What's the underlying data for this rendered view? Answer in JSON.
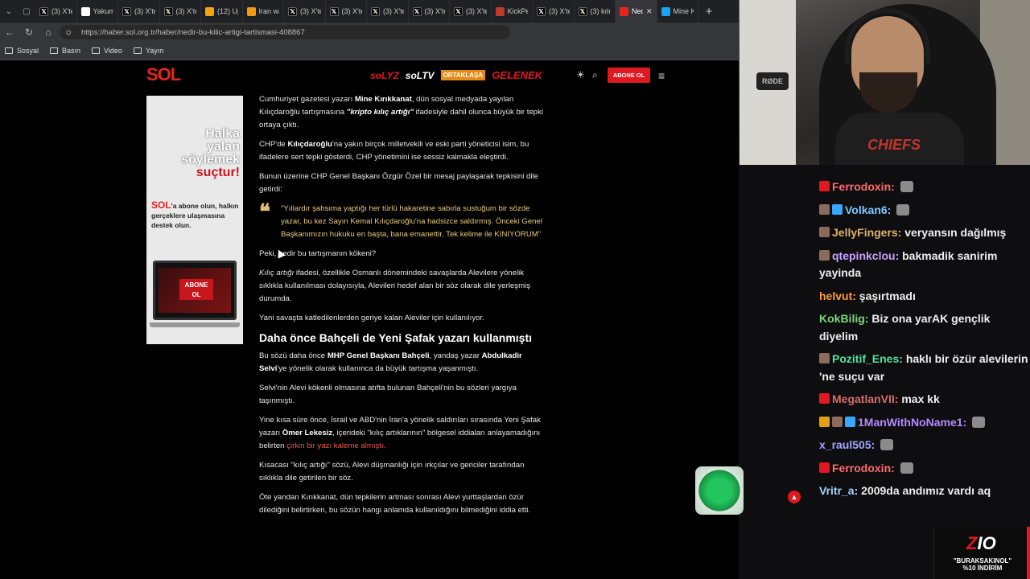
{
  "browser": {
    "tabs": [
      {
        "label": "(3) X'te",
        "icon": "x-icon",
        "color": "#000000"
      },
      {
        "label": "Yakumo",
        "icon": "amazon-icon",
        "color": "#ffffff"
      },
      {
        "label": "(3) X'te",
        "icon": "x-icon",
        "color": "#000000"
      },
      {
        "label": "(3) X'te",
        "icon": "x-icon",
        "color": "#000000"
      },
      {
        "label": "(12) Up",
        "icon": "upwork-icon",
        "color": "#f2a413"
      },
      {
        "label": "Iran wa",
        "icon": "news-icon",
        "color": "#f29a12"
      },
      {
        "label": "(3) X'te",
        "icon": "x-icon",
        "color": "#000000"
      },
      {
        "label": "(3) X'te",
        "icon": "x-icon",
        "color": "#000000"
      },
      {
        "label": "(3) X'te",
        "icon": "x-icon",
        "color": "#000000"
      },
      {
        "label": "(3) X'te",
        "icon": "x-icon",
        "color": "#000000"
      },
      {
        "label": "(3) X'te",
        "icon": "x-icon",
        "color": "#000000"
      },
      {
        "label": "KickPee",
        "icon": "kick-icon",
        "color": "#c0392b"
      },
      {
        "label": "(3) X'te",
        "icon": "x-icon",
        "color": "#000000"
      },
      {
        "label": "(3) kılıç",
        "icon": "x-icon",
        "color": "#000000"
      },
      {
        "label": "Ned",
        "icon": "sol-icon",
        "color": "#e52420",
        "active": true
      },
      {
        "label": "Mine Kı",
        "icon": "twitter-icon",
        "color": "#1da1f2"
      }
    ],
    "url": "https://haber.sol.org.tr/haber/nedir-bu-kilic-artigi-tartismasi-408867",
    "bookmarks": [
      "Sosyal",
      "Basın",
      "Video",
      "Yayın"
    ]
  },
  "site": {
    "logo": "SOL",
    "brands": [
      {
        "label": "soLYZ",
        "color": "#e0181f"
      },
      {
        "label": "soLTV",
        "color": "#ffffff"
      },
      {
        "label": "ORTAKLAŞA",
        "color": "#e58a12"
      },
      {
        "label": "GELENEK",
        "color": "#e0181f"
      }
    ],
    "subscribe_label": "ABONE OL"
  },
  "ad": {
    "headline": [
      "Halka",
      "yalan",
      "söylemek"
    ],
    "headline_red": "suçtur!",
    "brand": "SOL",
    "text": "'a abone olun, halkın gerçeklere ulaşmasına destek olun.",
    "button": "ABONE OL"
  },
  "article": {
    "p1_a": "Cumhuriyet gazetesi yazarı ",
    "p1_b": "Mine Kırıkkanat",
    "p1_c": ", dün sosyal medyada yayılan Kılıçdaroğlu tartışmasına ",
    "p1_d": "\"kripto kılıç artığı\"",
    "p1_e": " ifadesiyle dahil olunca büyük bir tepki ortaya çıktı.",
    "p2_a": "CHP'de ",
    "p2_b": "Kılıçdaroğlu",
    "p2_c": "'na yakın birçok milletvekili ve eski parti yöneticisi isim, bu ifadelere sert tepki gösterdi, CHP yönetimini ise sessiz kalmakla eleştirdi.",
    "p3": "Bunun üzerine CHP Genel Başkanı Özgür Özel bir mesaj paylaşarak tepkisini dile getirdi:",
    "quote": "\"Yıllardır şahsıma yaptığı her türlü hakaretine sabırla sustuğum bir sözde yazar, bu kez Sayın Kemal Kılıçdaroğlu'na hadsizce saldırmış. Önceki Genel Başkanımızın hukuku en başta, bana emanettir. Tek kelime ile KINIYORUM\"",
    "p4": "Peki, nedir bu tartışmanın kökeni?",
    "p5_a": "Kılıç artığı",
    "p5_b": " ifadesi, özellikle Osmanlı dönemindeki savaşlarda Alevilere yönelik sıklıkla kullanılması dolayısıyla, Alevileri hedef alan bir söz olarak dile yerleşmiş durumda.",
    "p6": "Yani savaşta katledilenlerden geriye kalan Aleviler için kullanılıyor.",
    "h2": "Daha önce Bahçeli de Yeni Şafak yazarı kullanmıştı",
    "p7_a": "Bu sözü daha önce ",
    "p7_b": "MHP Genel Başkanı Bahçeli",
    "p7_c": ", yandaş yazar ",
    "p7_d": "Abdulkadir Selvi",
    "p7_e": "'ye yönelik olarak kullanınca da büyük tartışma yaşanmıştı.",
    "p8": "Selvi'nin Alevi kökenli olmasına atıfta bulunan Bahçeli'nin bu sözleri yargıya taşınmıştı.",
    "p9_a": "Yine kısa süre önce, İsrail ve ABD'nin İran'a yönelik saldırıları sırasında Yeni Şafak yazarı ",
    "p9_b": "Ömer Lekesiz",
    "p9_c": ", içerideki \"kılıç artıklarının\" bölgesel iddiaları anlayamadığını belirten ",
    "p9_d": "çirkin bir yazı kaleme almıştı.",
    "p10": "Kısacası \"kılıç artığı\" sözü, Alevi düşmanlığı için ırkçılar ve gericiler tarafından sıklıkla dile getirilen bir söz.",
    "p11": "Öte yandan Kırıkkanat, dün tepkilerin artması sonrası Alevi yurttaşlardan özür dilediğini belirtirken, bu sözün hangi anlamda kullanıldığını bilmediğini iddia etti."
  },
  "webcam": {
    "mic_label": "RØDE",
    "shirt_text": "CHIEFS"
  },
  "chat": [
    {
      "user": "Ferrodoxin",
      "color": "#ff6b6b",
      "badges": [
        "#e0181f"
      ],
      "text": "",
      "emote": true
    },
    {
      "user": "Volkan6",
      "color": "#7fc8ff",
      "badges": [
        "#8b6b5c",
        "#3aa7ff"
      ],
      "text": "",
      "emote": true
    },
    {
      "user": "JellyFingers",
      "color": "#e0b36b",
      "badges": [
        "#8b6b5c"
      ],
      "text": "veryansın dağılmış",
      "emote": false
    },
    {
      "user": "qtepinkclou",
      "color": "#c5a3ff",
      "badges": [
        "#8b6b5c"
      ],
      "text": "bakmadik sanirim yayinda",
      "emote": false
    },
    {
      "user": "helvut",
      "color": "#ff9a3c",
      "badges": [],
      "text": "şaşırtmadı",
      "emote": false
    },
    {
      "user": "KokBilig",
      "color": "#7ad67a",
      "badges": [],
      "text": "Biz ona yarAK gençlik diyelim",
      "emote": false
    },
    {
      "user": "Pozitif_Enes",
      "color": "#55e0a0",
      "badges": [
        "#8b6b5c"
      ],
      "text": "haklı bir özür alevilerin 'ne suçu var",
      "emote": false
    },
    {
      "user": "MegatlanVII",
      "color": "#d66b6b",
      "badges": [
        "#e0181f"
      ],
      "text": "max kk",
      "emote": false
    },
    {
      "user": "1ManWithNoName1",
      "color": "#b58aff",
      "badges": [
        "#e0a010",
        "#8b6b5c",
        "#3aa7ff"
      ],
      "text": "",
      "emote": true
    },
    {
      "user": "x_raul505",
      "color": "#a3a3ff",
      "badges": [],
      "text": "",
      "emote": true
    },
    {
      "user": "Ferrodoxin",
      "color": "#ff6b6b",
      "badges": [
        "#e0181f"
      ],
      "text": "",
      "emote": true
    },
    {
      "user": "Vritr_a",
      "color": "#9fd3ff",
      "badges": [],
      "text": "2009da andımız vardı aq",
      "emote": false
    }
  ],
  "sponsor": {
    "logo_a": "Z",
    "logo_b": "IO",
    "code_line1": "\"BURAKSAKINOL\"",
    "code_line2": "%10 İNDİRİM"
  }
}
